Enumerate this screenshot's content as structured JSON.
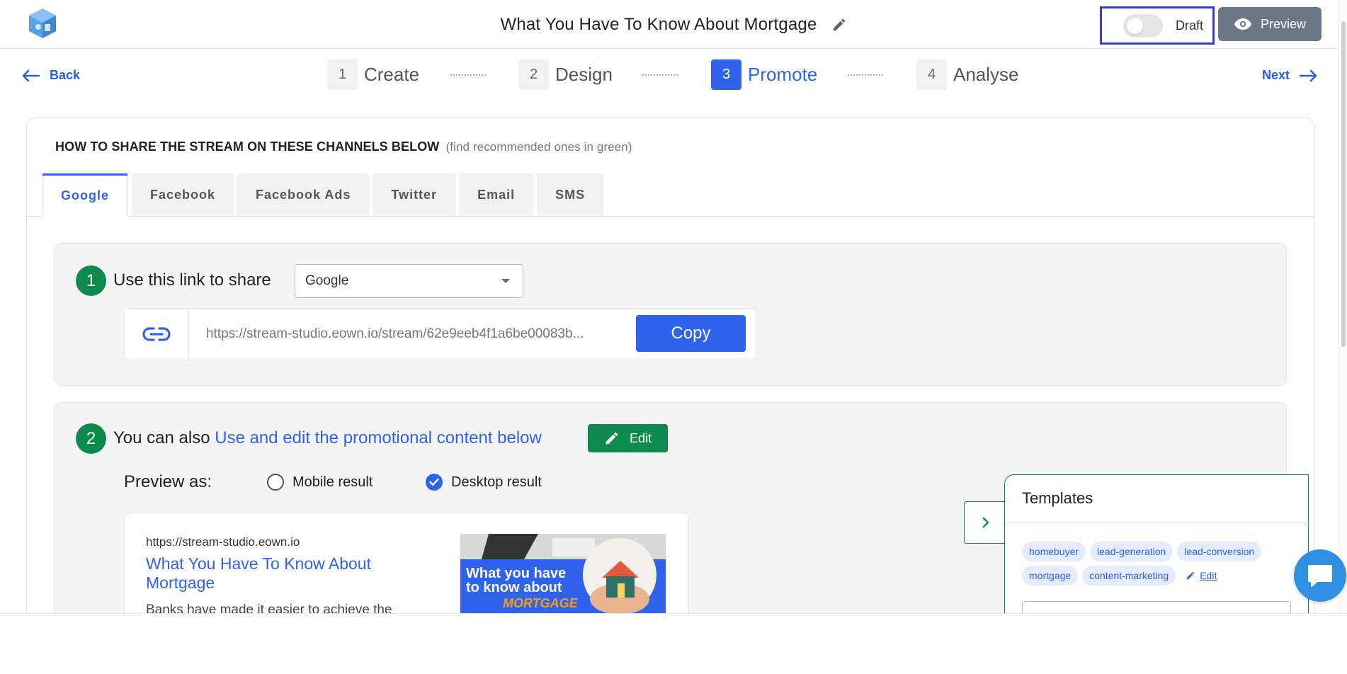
{
  "header": {
    "title": "What You Have To Know About Mortgage",
    "draft_label": "Draft",
    "preview_label": "Preview"
  },
  "nav": {
    "back_label": "Back",
    "next_label": "Next",
    "steps": [
      {
        "num": "1",
        "label": "Create"
      },
      {
        "num": "2",
        "label": "Design"
      },
      {
        "num": "3",
        "label": "Promote"
      },
      {
        "num": "4",
        "label": "Analyse"
      }
    ],
    "active_step": 3
  },
  "share": {
    "heading": "HOW TO SHARE THE STREAM ON THESE CHANNELS BELOW",
    "hint": "(find recommended ones in green)",
    "tabs": [
      "Google",
      "Facebook",
      "Facebook Ads",
      "Twitter",
      "Email",
      "SMS"
    ],
    "active_tab": "Google"
  },
  "section1": {
    "number": "1",
    "label": "Use this link to share",
    "select_value": "Google",
    "link_url": "https://stream-studio.eown.io/stream/62e9eeb4f1a6be00083b...",
    "copy_label": "Copy"
  },
  "section2": {
    "number": "2",
    "label_prefix": "You can also",
    "label_link": "Use and edit the promotional content below",
    "edit_label": "Edit",
    "preview_as_label": "Preview as:",
    "radio_mobile": "Mobile result",
    "radio_desktop": "Desktop result",
    "selected_preview": "Desktop result",
    "serp": {
      "url": "https://stream-studio.eown.io",
      "title": "What You Have To Know About Mortgage",
      "description": "Banks have made it easier to achieve the"
    },
    "thumbnail_text": {
      "line1": "What you have",
      "line2": "to know about",
      "line3": "MORTGAGE"
    }
  },
  "templates": {
    "title": "Templates",
    "tags": [
      "homebuyer",
      "lead-generation",
      "lead-conversion",
      "mortgage",
      "content-marketing"
    ],
    "edit_label": "Edit"
  },
  "colors": {
    "accent": "#2f63ec",
    "success": "#0e8a4f",
    "preview_button": "#6b7785",
    "focus_outline": "#3b3bd6"
  }
}
